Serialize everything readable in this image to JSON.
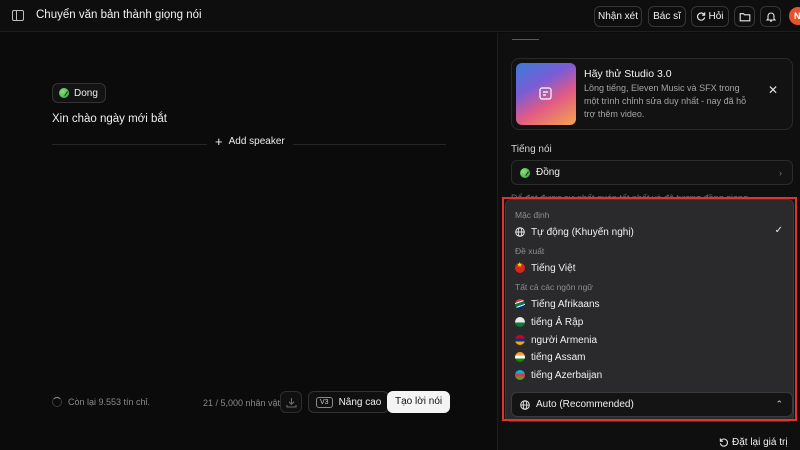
{
  "topbar": {
    "title": "Chuyển văn bản thành giọng nói",
    "feedback_label": "Nhận xét",
    "doctor_label": "Bác sĩ",
    "ask_label": "Hỏi",
    "avatar_initial": "N"
  },
  "editor": {
    "speaker_name": "Dong",
    "text": "Xin chào ngày mới bắt",
    "add_speaker_label": "Add speaker",
    "credits_text": "Còn lại 9.553 tín chỉ.",
    "char_count": "21 / 5,000 nhân vật",
    "model_badge": "V3",
    "advanced_label": "Nâng cao",
    "generate_label": "Tạo lời nói"
  },
  "panel": {
    "promo_title": "Hãy thử Studio 3.0",
    "promo_desc": "Lồng tiếng, Eleven Music và SFX trong một trình chỉnh sửa duy nhất - nay đã hỗ trợ thêm video.",
    "voice_section_label": "Tiếng nói",
    "voice_value": "Đồng",
    "ghost_text": "Để đạt được sự nhất quán tốt nhất và độ tương đồng giọng",
    "language_value": "Auto (Recommended)",
    "reset_label": "Đặt lại giá trị"
  },
  "lang_menu": {
    "group_default": "Mặc định",
    "auto_option": "Tự động (Khuyến nghị)",
    "group_suggested": "Đề xuất",
    "suggested_option": "Tiếng Việt",
    "group_all": "Tất cả các ngôn ngữ",
    "languages": [
      "Tiếng Afrikaans",
      "tiếng Ả Rập",
      "người Armenia",
      "tiếng Assam",
      "tiếng Azerbaijan"
    ]
  },
  "colors": {
    "accent_highlight": "#e0332e",
    "avatar": "#e5532b",
    "primary_button": "#f4f4f4"
  }
}
